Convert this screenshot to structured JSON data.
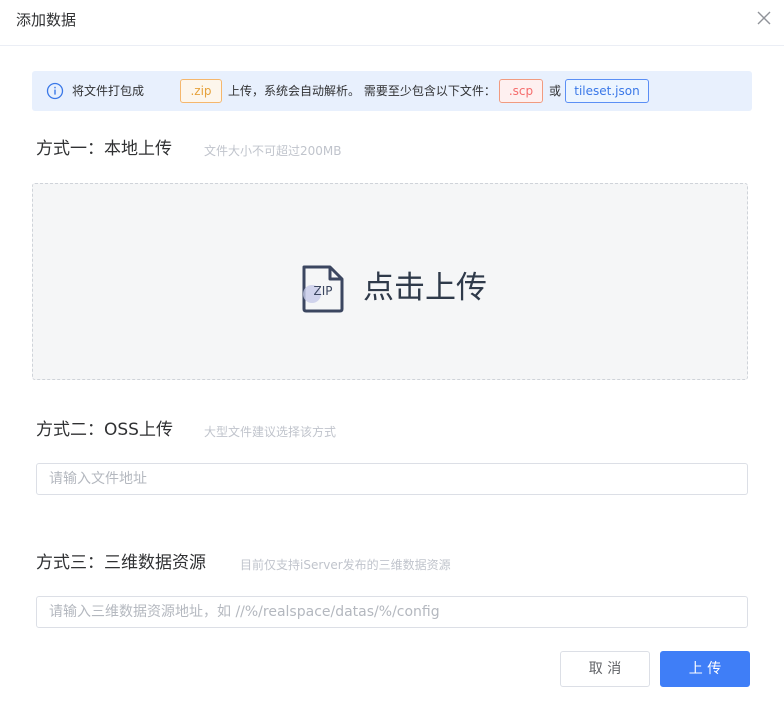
{
  "dialog": {
    "title": "添加数据"
  },
  "notice": {
    "text_before": "将文件打包成",
    "zip_tag": ".zip",
    "text_middle": "上传，系统会自动解析。 需要至少包含以下文件：",
    "scp_tag": ".scp",
    "or_text": "或",
    "tileset_tag": "tileset.json",
    "info_color": "#3a78e8"
  },
  "method1": {
    "title": "方式一：本地上传",
    "hint": "文件大小不可超过200MB",
    "icon_label": "ZIP",
    "upload_label": "点击上传"
  },
  "method2": {
    "title": "方式二：OSS上传",
    "hint": "大型文件建议选择该方式",
    "input_value": "",
    "input_placeholder": "请输入文件地址"
  },
  "method3": {
    "title": "方式三：三维数据资源",
    "hint": "目前仅支持iServer发布的三维数据资源",
    "input_value": "",
    "input_placeholder": "请输入三维数据资源地址，如 //%/realspace/datas/%/config"
  },
  "footer": {
    "cancel_label": "取 消",
    "submit_label": "上 传",
    "primary_color": "#3f7ef7"
  }
}
